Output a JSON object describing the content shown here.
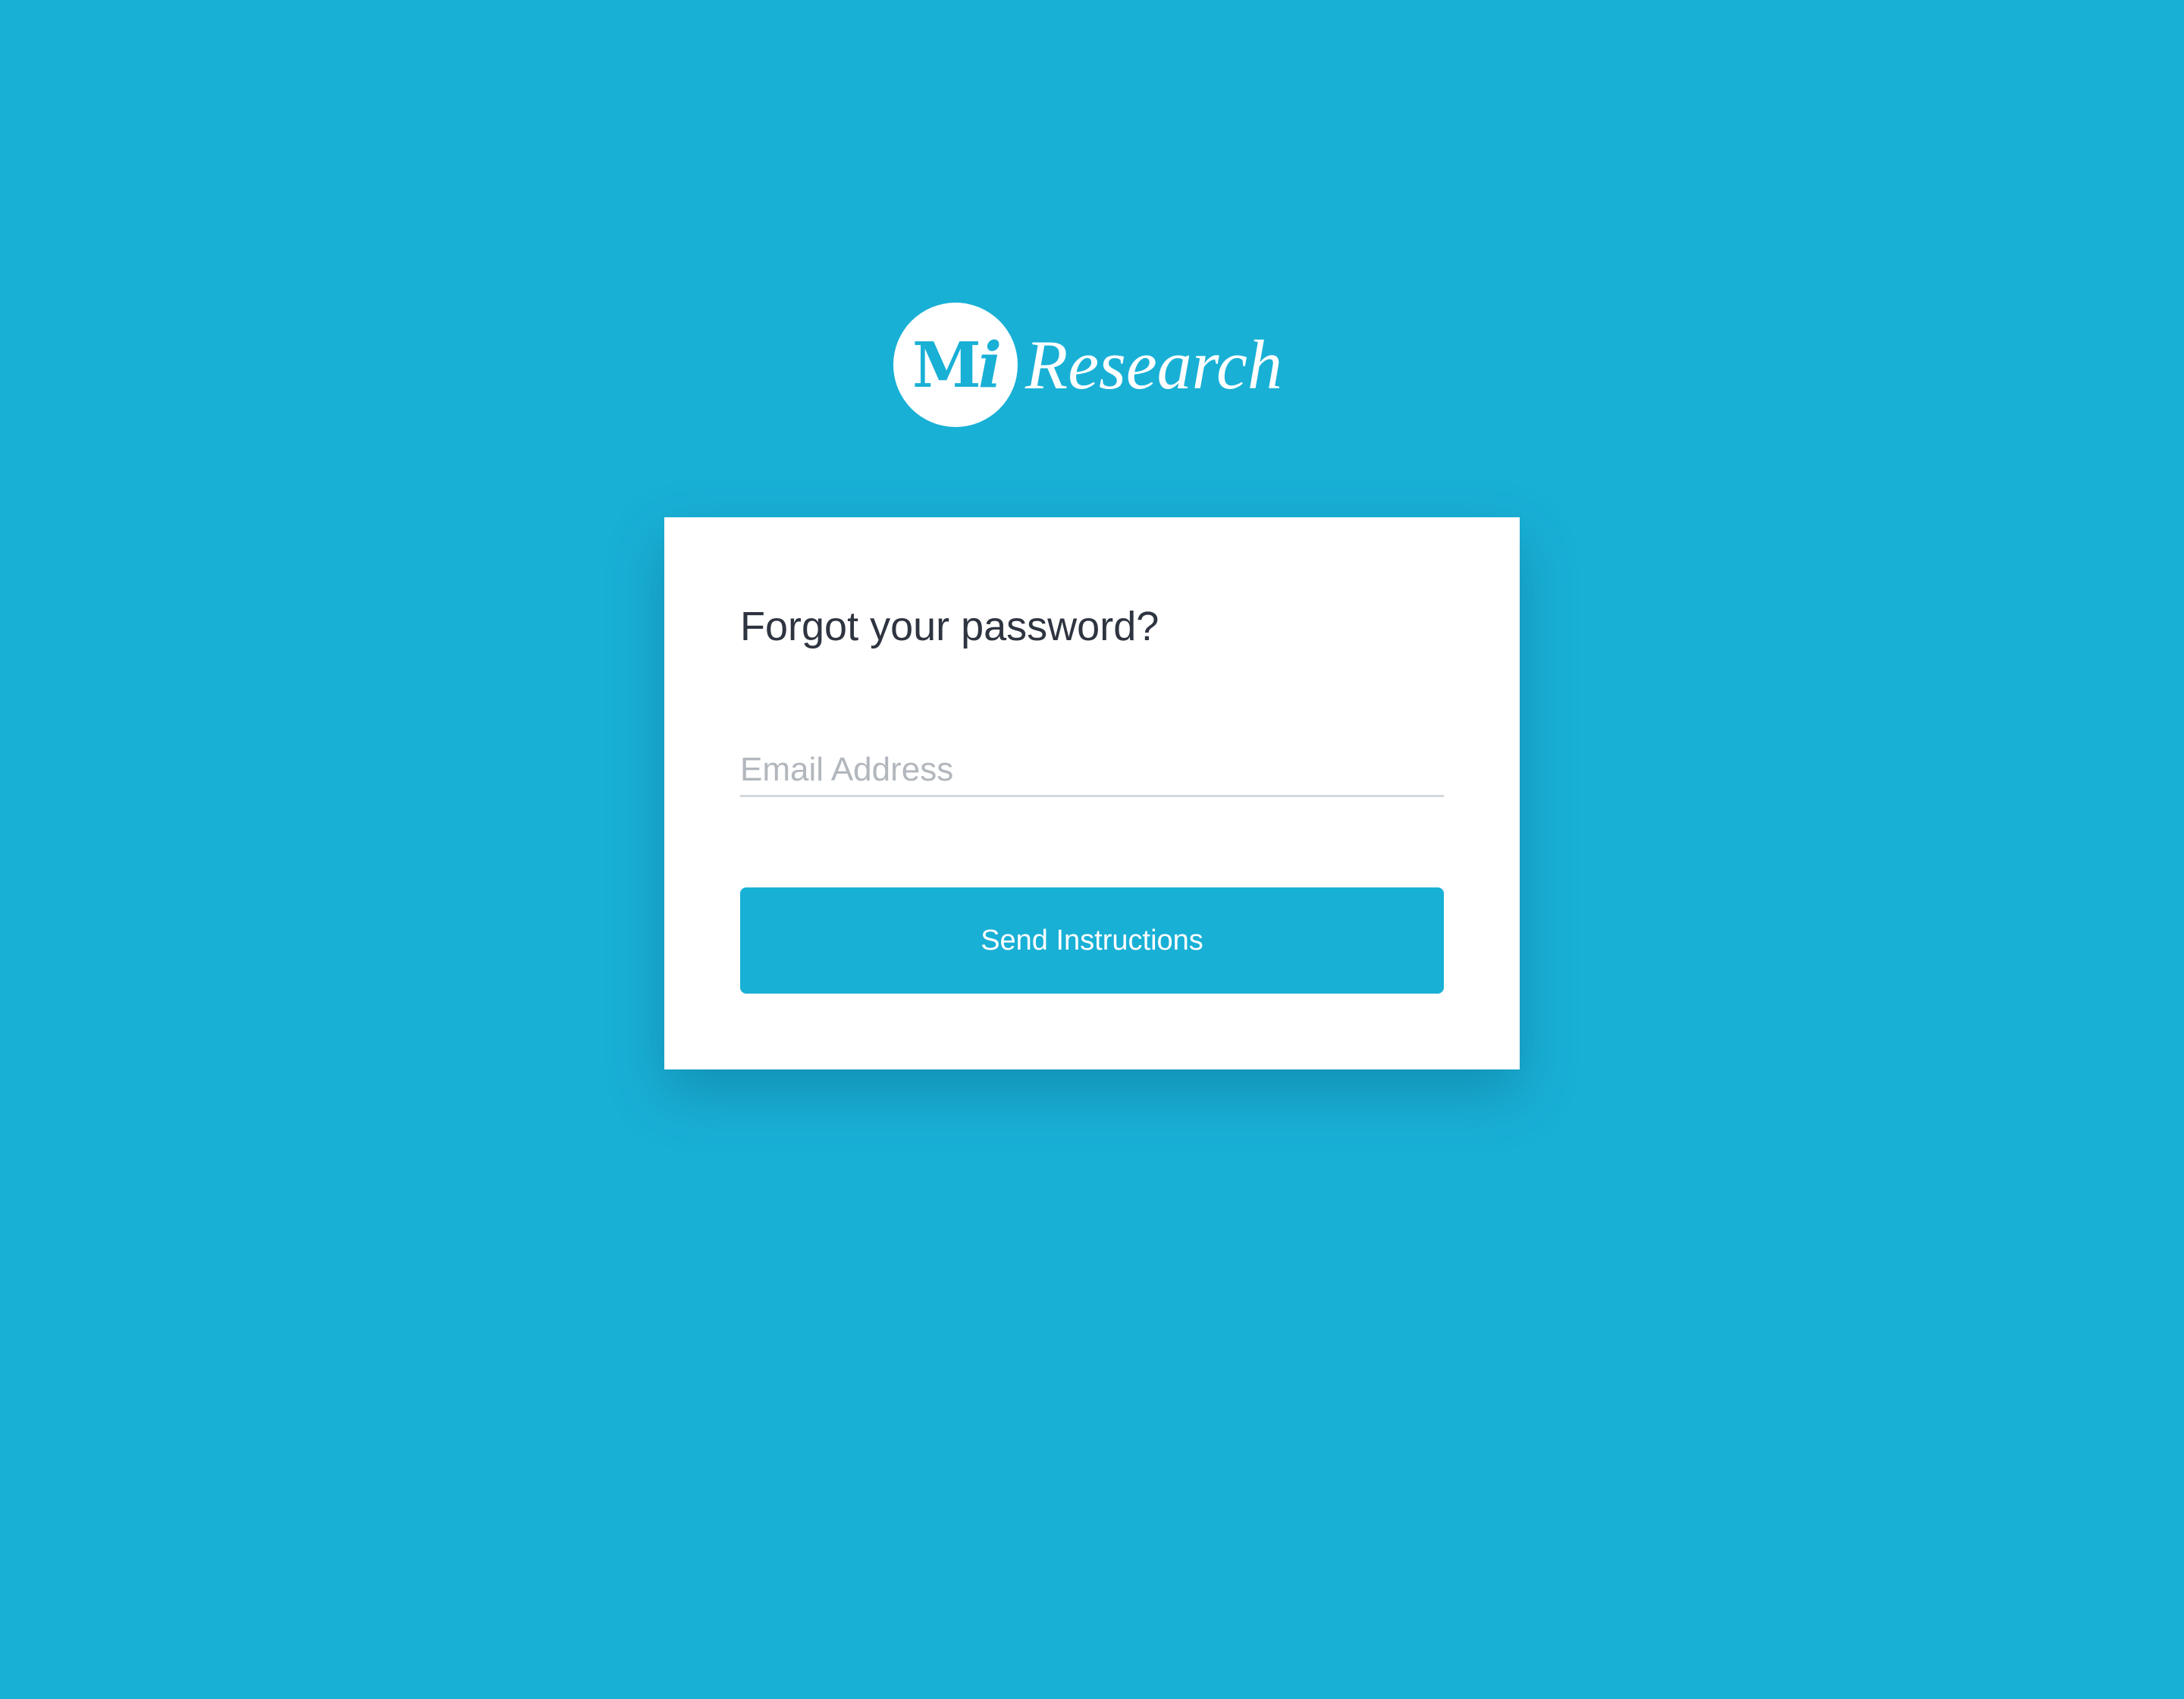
{
  "colors": {
    "background": "#19b0d6",
    "card_background": "#ffffff",
    "accent": "#19b0d6",
    "title_text": "#2e3440",
    "placeholder_text": "#b2b7bd",
    "divider": "#d4d7db"
  },
  "logo": {
    "mark_letters": "M",
    "mark_italic_letter": "i",
    "wordmark": "Research"
  },
  "form": {
    "title": "Forgot your password?",
    "email": {
      "value": "",
      "placeholder": "Email Address"
    },
    "submit_label": "Send Instructions"
  }
}
